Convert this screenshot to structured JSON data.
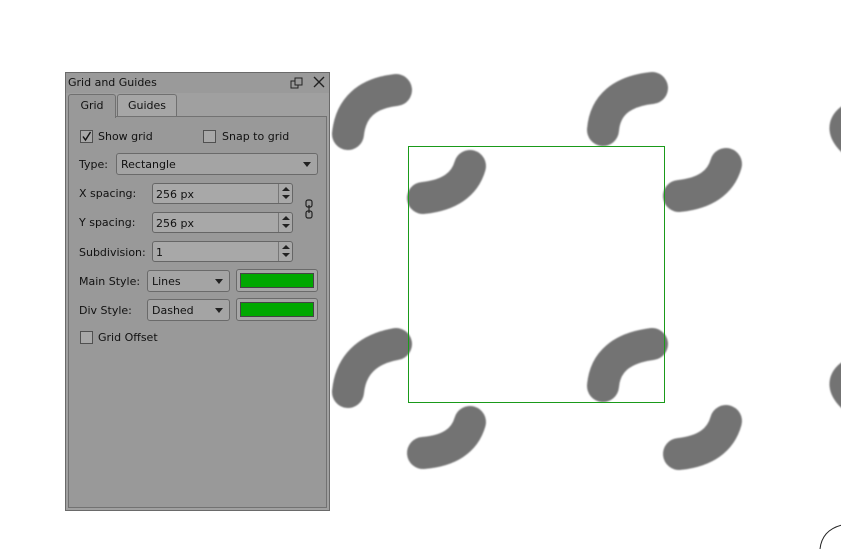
{
  "panel": {
    "title": "Grid and Guides",
    "tabs": [
      {
        "label": "Grid",
        "active": true
      },
      {
        "label": "Guides",
        "active": false
      }
    ],
    "show_grid": {
      "label": "Show grid",
      "checked": true
    },
    "snap_to_grid": {
      "label": "Snap to grid",
      "checked": false
    },
    "type": {
      "label": "Type:",
      "value": "Rectangle"
    },
    "x_spacing": {
      "label": "X spacing:",
      "value": "256 px"
    },
    "y_spacing": {
      "label": "Y spacing:",
      "value": "256 px"
    },
    "subdivision": {
      "label": "Subdivision:",
      "value": "1"
    },
    "main_style": {
      "label": "Main Style:",
      "value": "Lines",
      "color": "#00a800"
    },
    "div_style": {
      "label": "Div Style:",
      "value": "Dashed",
      "color": "#00a800"
    },
    "grid_offset": {
      "label": "Grid Offset",
      "checked": false
    }
  },
  "canvas": {
    "grid_color": "#1a9a1a",
    "stroke_color": "#737373"
  },
  "icons": {
    "float": "float-window-icon",
    "close": "close-icon",
    "chain": "chain-link-icon",
    "checkmark": "checkmark-icon",
    "brush_cursor": "brush-cursor-icon"
  }
}
